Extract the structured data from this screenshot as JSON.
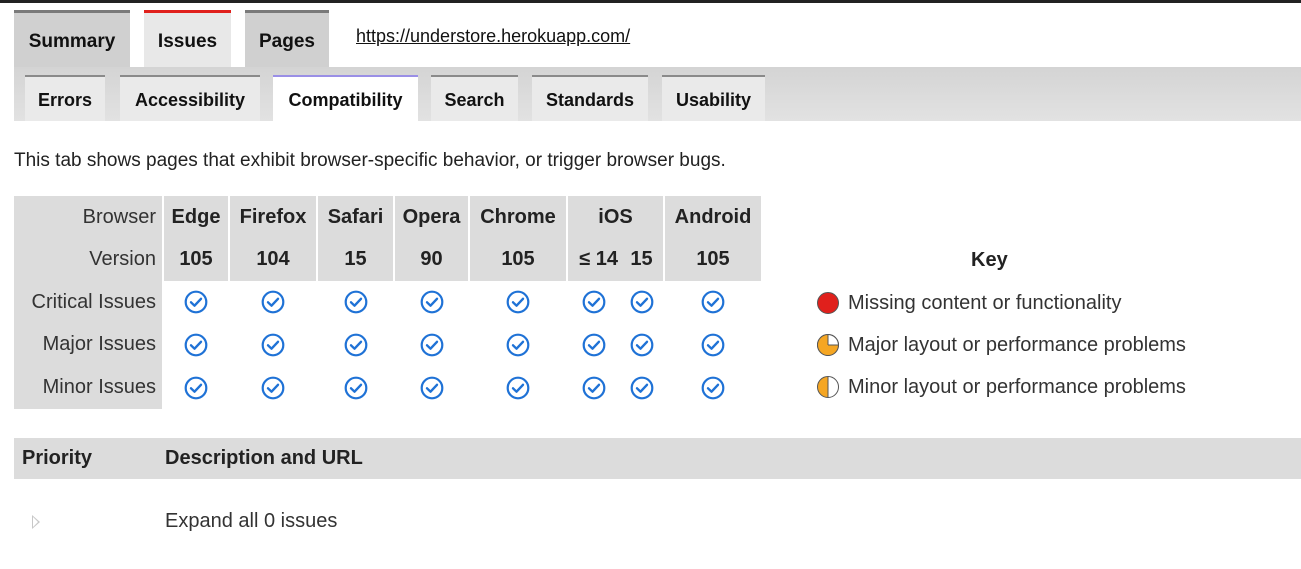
{
  "top_tabs": [
    "Summary",
    "Issues",
    "Pages"
  ],
  "active_top_tab": "Issues",
  "url": "https://understore.herokuapp.com/",
  "sub_tabs": [
    "Errors",
    "Accessibility",
    "Compatibility",
    "Search",
    "Standards",
    "Usability"
  ],
  "active_sub_tab": "Compatibility",
  "intro": "This tab shows pages that exhibit browser-specific behavior, or trigger browser bugs.",
  "grid": {
    "browser_label": "Browser",
    "version_label": "Version",
    "browsers": {
      "edge": {
        "name": "Edge",
        "version": "105"
      },
      "firefox": {
        "name": "Firefox",
        "version": "104"
      },
      "safari": {
        "name": "Safari",
        "version": "15"
      },
      "opera": {
        "name": "Opera",
        "version": "90"
      },
      "chrome": {
        "name": "Chrome",
        "version": "105"
      },
      "ios": {
        "name": "iOS",
        "versions": [
          "≤ 14",
          "15"
        ]
      },
      "android": {
        "name": "Android",
        "version": "105"
      }
    },
    "rows": [
      "Critical Issues",
      "Major Issues",
      "Minor Issues"
    ],
    "status_icon": "check-circle-icon",
    "check_color": "#1f72d6"
  },
  "key": {
    "title": "Key",
    "items": [
      {
        "label": "Missing content or functionality",
        "icon": "red-circle-icon",
        "color": "#e0201c"
      },
      {
        "label": "Major layout or performance problems",
        "icon": "three-quarter-circle-icon",
        "color": "#f5a623"
      },
      {
        "label": "Minor layout or performance problems",
        "icon": "half-circle-icon",
        "color": "#f5a623"
      }
    ]
  },
  "issues_table": {
    "headers": [
      "Priority",
      "Description and URL"
    ],
    "expand_text": "Expand all 0 issues"
  }
}
